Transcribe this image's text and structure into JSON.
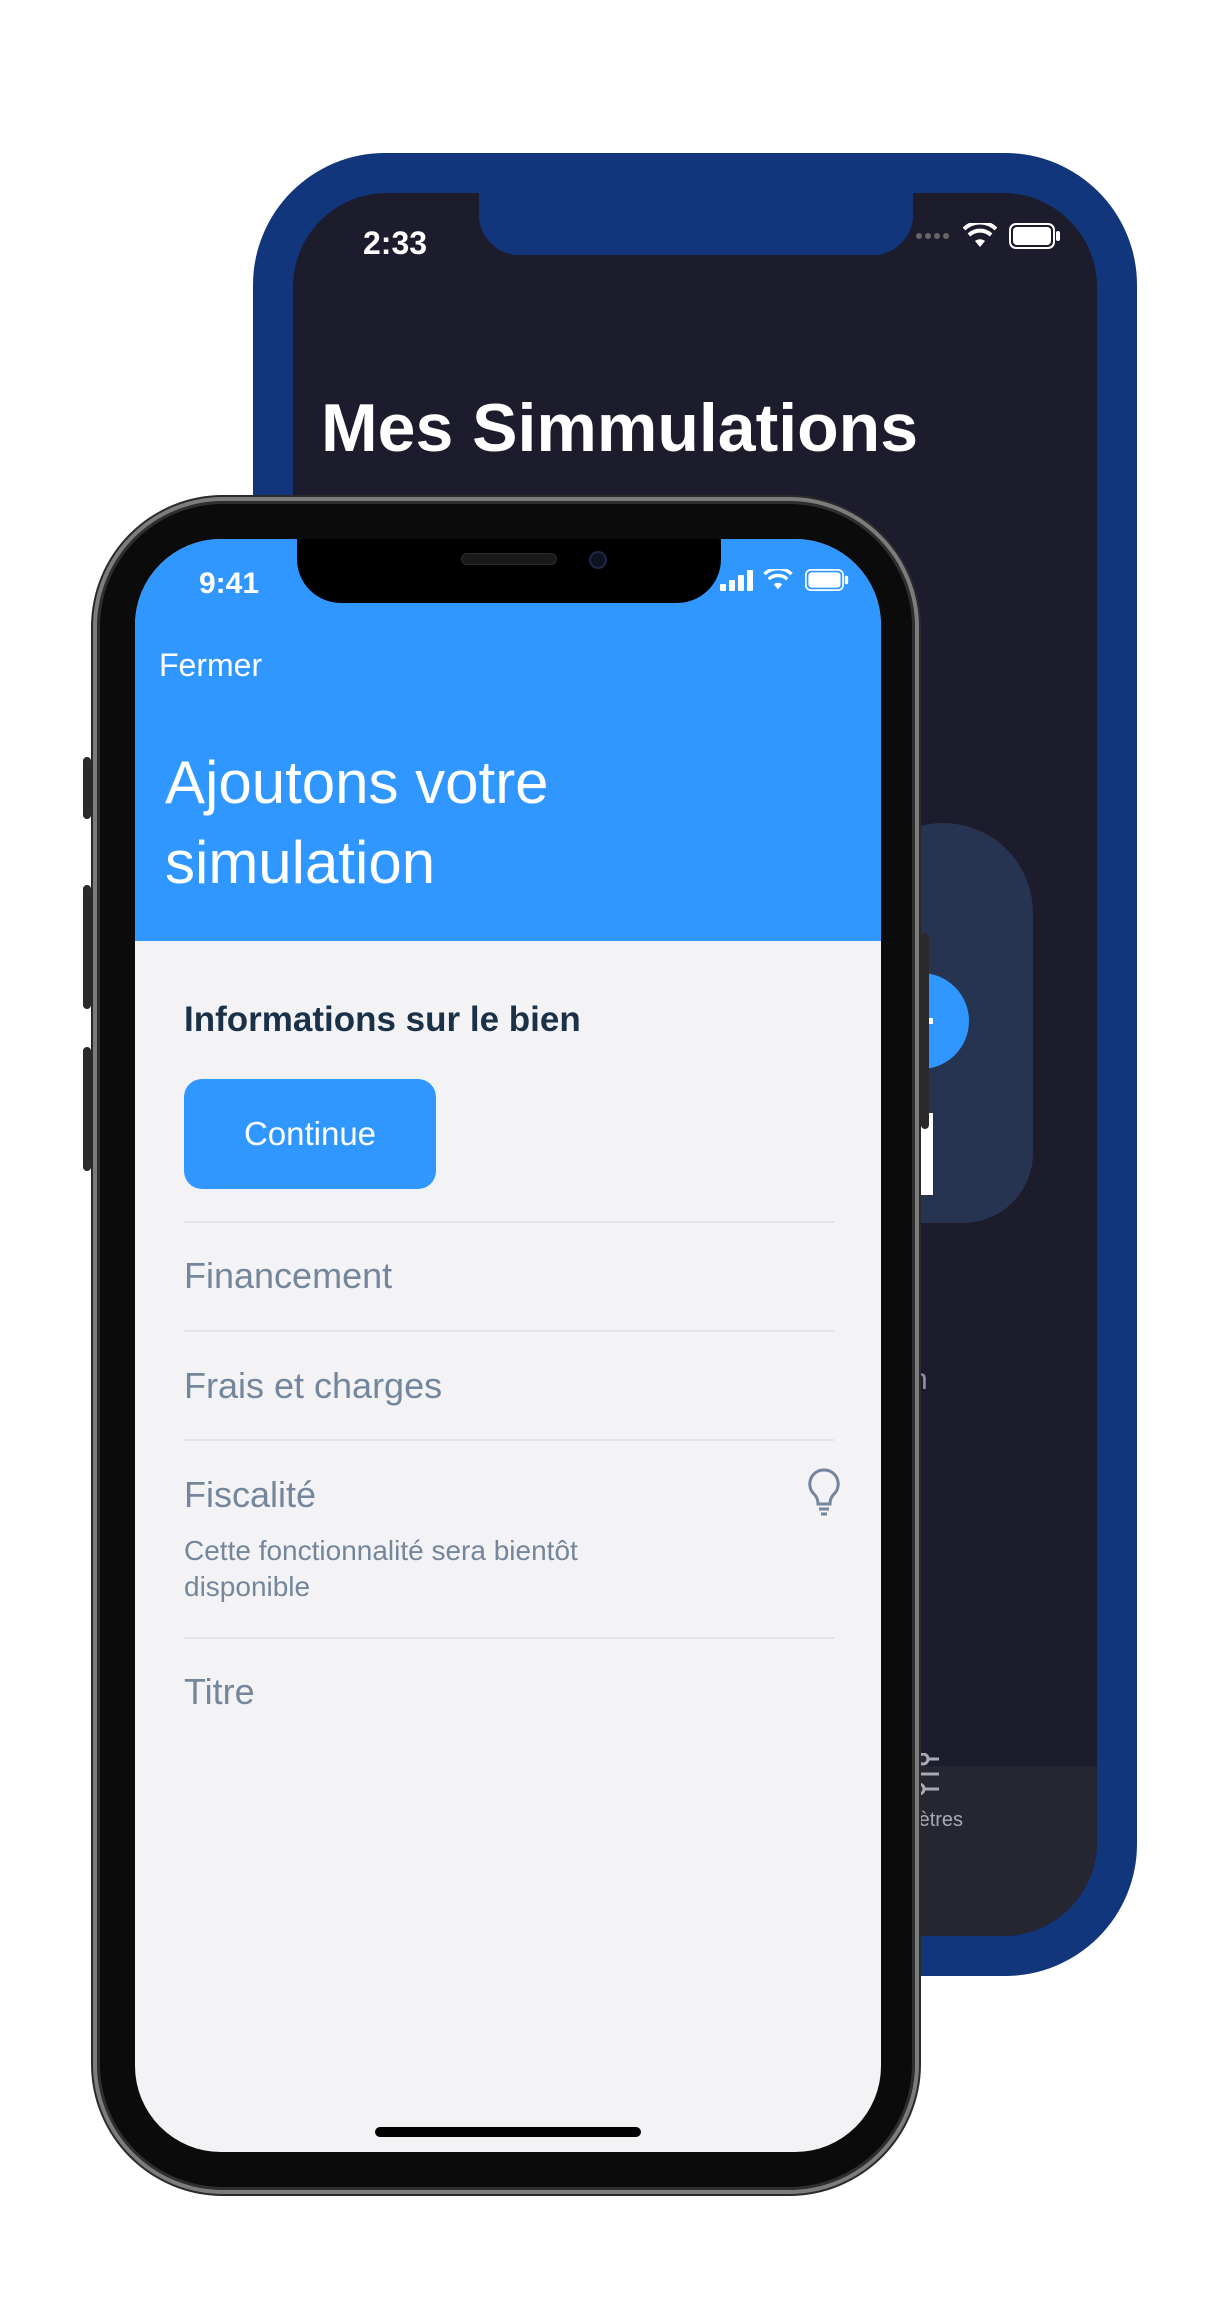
{
  "back_screen": {
    "status_time": "2:33",
    "title": "Mes Simmulations",
    "partial_text": "n",
    "tabbar": {
      "settings_label": "aramètres"
    },
    "colors": {
      "frame": "#12367c",
      "screen": "#1c1c2c",
      "accent": "#2f97ff"
    }
  },
  "front_screen": {
    "status_time": "9:41",
    "header": {
      "close_label": "Fermer",
      "title": "Ajoutons votre simulation"
    },
    "steps": [
      {
        "label": "Informations sur le bien",
        "state": "active",
        "button_label": "Continue"
      },
      {
        "label": "Financement",
        "state": "inactive"
      },
      {
        "label": "Frais et charges",
        "state": "inactive"
      },
      {
        "label": "Fiscalité",
        "state": "disabled",
        "note": "Cette fonctionnalité sera bientôt disponible",
        "icon": "lightbulb-icon"
      },
      {
        "label": "Titre",
        "state": "inactive"
      }
    ],
    "colors": {
      "header": "#2f97ff",
      "background": "#f3f3f6",
      "active_text": "#1a3148",
      "inactive_text": "#74869b"
    }
  }
}
